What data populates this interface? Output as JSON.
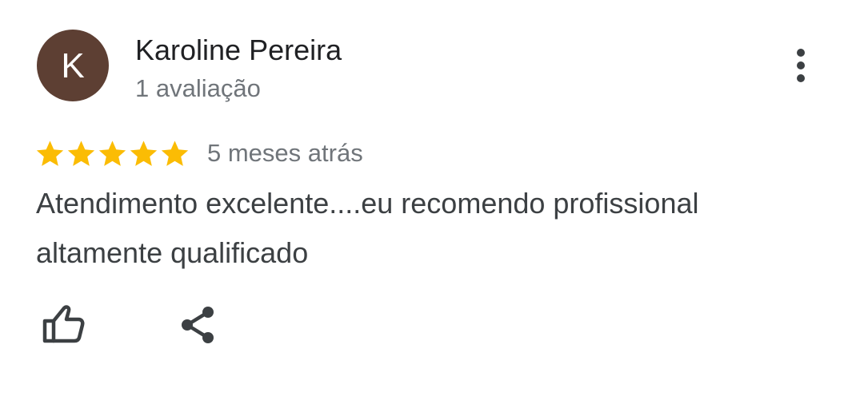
{
  "review": {
    "author": {
      "initial": "K",
      "name": "Karoline Pereira",
      "review_count": "1 avaliação",
      "avatar_color": "#5d3f33"
    },
    "rating": 5,
    "max_rating": 5,
    "star_color": "#fbbc04",
    "time": "5 meses atrás",
    "text": "Atendimento excelente....eu recomendo profissional altamente qualificado",
    "actions": {
      "like_icon": "thumb-up-icon",
      "share_icon": "share-icon",
      "more_icon": "more-vert-icon"
    }
  }
}
